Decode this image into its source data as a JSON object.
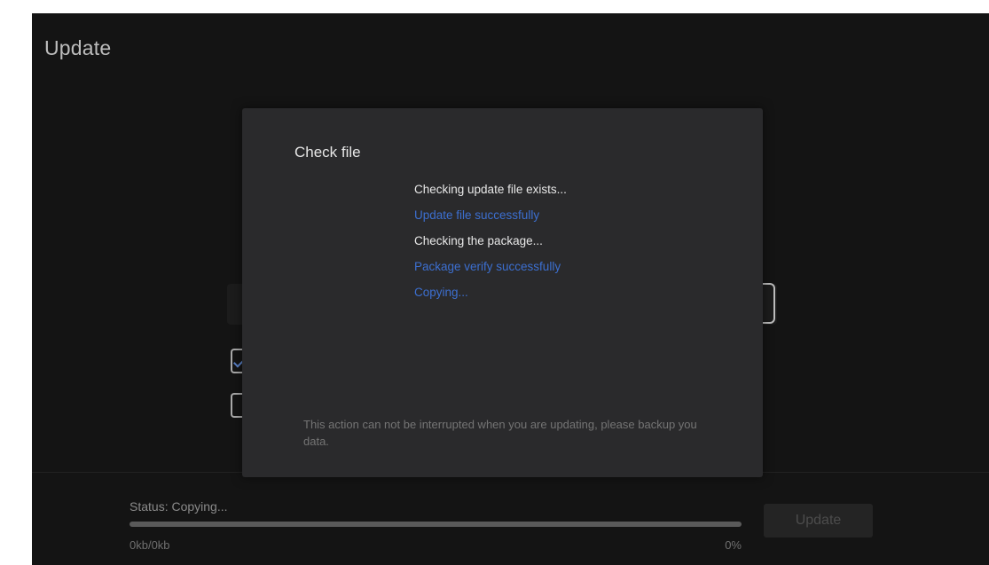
{
  "page": {
    "title": "Update"
  },
  "background_controls": {
    "checkbox_1_checked": true,
    "checkbox_2_checked": false
  },
  "dialog": {
    "title": "Check file",
    "log": [
      {
        "text": "Checking update file exists...",
        "kind": "info"
      },
      {
        "text": "Update file successfully",
        "kind": "success"
      },
      {
        "text": "Checking the package...",
        "kind": "info"
      },
      {
        "text": "Package verify successfully",
        "kind": "success"
      },
      {
        "text": "Copying...",
        "kind": "success"
      }
    ],
    "note": "This action can not be interrupted when you are updating, please backup you data."
  },
  "footer": {
    "status_text": "Status: Copying...",
    "progress_fraction": 0,
    "size_text": "0kb/0kb",
    "percent_text": "0%",
    "update_button_label": "Update"
  },
  "colors": {
    "background": "#141414",
    "dialog": "#2a2a2c",
    "success_text": "#3c6fd0",
    "info_text": "#e8e8e8"
  }
}
